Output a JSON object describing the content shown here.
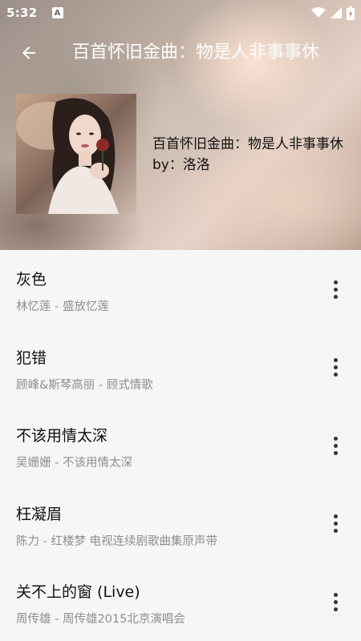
{
  "status_bar": {
    "time": "5:32",
    "notification_icon": "A",
    "icons": [
      "wifi-icon",
      "signal-icon",
      "battery-charging-icon"
    ]
  },
  "toolbar": {
    "back_icon": "arrow-left-icon",
    "title": "百首怀旧金曲：物是人非事事休"
  },
  "playlist": {
    "name": "百首怀旧金曲：物是人非事事休",
    "author": "by：洛洛"
  },
  "songs": [
    {
      "title": "灰色",
      "subtitle": "林忆莲 - 盛放忆莲"
    },
    {
      "title": "犯错",
      "subtitle": "顾峰&斯琴高丽 - 顾式情歌"
    },
    {
      "title": "不该用情太深",
      "subtitle": "吴姗姗 - 不该用情太深"
    },
    {
      "title": "枉凝眉",
      "subtitle": "陈力 - 红楼梦 电视连续剧歌曲集原声带"
    },
    {
      "title": "关不上的窗 (Live)",
      "subtitle": "周传雄 - 周传雄2015北京演唱会"
    }
  ],
  "colors": {
    "title_text": "#ffffff",
    "list_background": "#f6f6f6",
    "subtitle_text": "#8e8e8e"
  }
}
